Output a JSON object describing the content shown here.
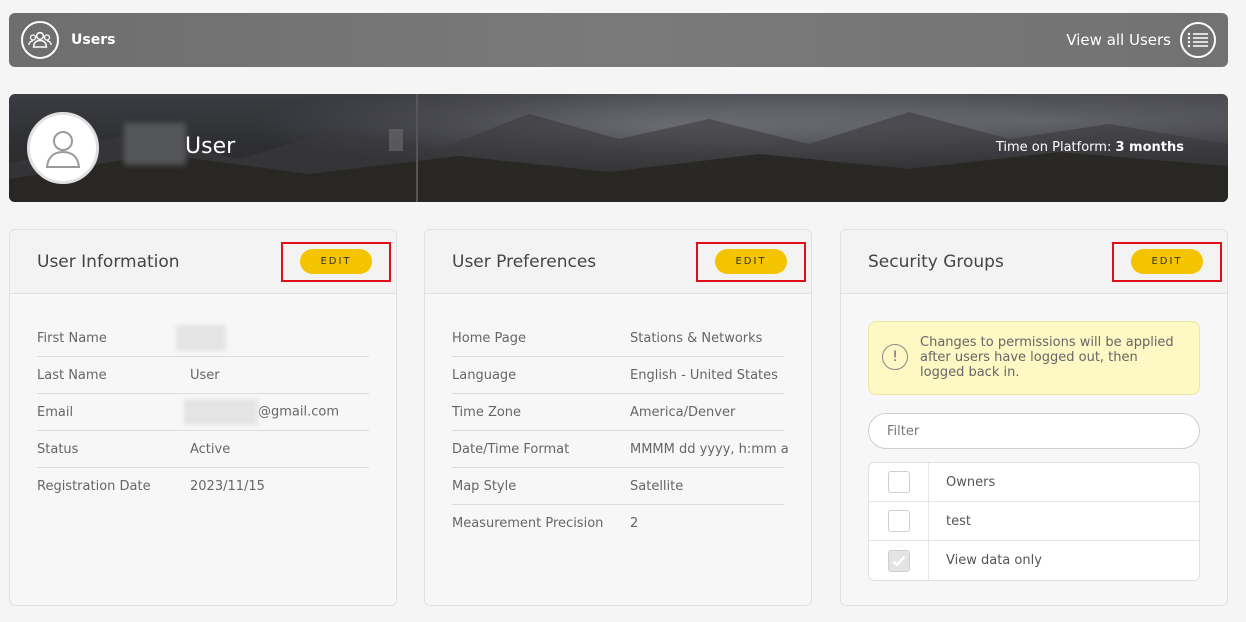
{
  "topbar": {
    "title": "Users",
    "view_all_label": "View all Users",
    "users_icon": "users-group-icon",
    "list_icon": "list-icon"
  },
  "banner": {
    "user_name": "User",
    "time_label": "Time on Platform:",
    "time_value": "3 months"
  },
  "edit_label": "EDIT",
  "user_info": {
    "title": "User Information",
    "rows": [
      {
        "label": "First Name",
        "value": ""
      },
      {
        "label": "Last Name",
        "value": "User"
      },
      {
        "label": "Email",
        "value": "@gmail.com"
      },
      {
        "label": "Status",
        "value": "Active"
      },
      {
        "label": "Registration Date",
        "value": "2023/11/15"
      }
    ]
  },
  "prefs": {
    "title": "User Preferences",
    "rows": [
      {
        "label": "Home Page",
        "value": "Stations & Networks"
      },
      {
        "label": "Language",
        "value": "English - United States"
      },
      {
        "label": "Time Zone",
        "value": "America/Denver"
      },
      {
        "label": "Date/Time Format",
        "value": "MMMM dd yyyy, h:mm a"
      },
      {
        "label": "Map Style",
        "value": "Satellite"
      },
      {
        "label": "Measurement Precision",
        "value": "2"
      }
    ]
  },
  "security": {
    "title": "Security Groups",
    "notice": "Changes to permissions will be applied after users have logged out, then logged back in.",
    "filter_placeholder": "Filter",
    "groups": [
      {
        "name": "Owners",
        "checked": false
      },
      {
        "name": "test",
        "checked": false
      },
      {
        "name": "View data only",
        "checked": true
      }
    ]
  },
  "colors": {
    "accent": "#f5c400",
    "highlight": "#e0101a"
  }
}
